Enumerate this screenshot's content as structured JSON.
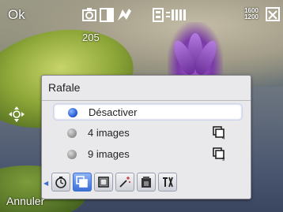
{
  "softkeys": {
    "left_top": "Ok",
    "bottom_left": "Annuler"
  },
  "status": {
    "shots_remaining": "205",
    "resolution_top": "1600",
    "resolution_bottom": "1200",
    "icons": [
      "camera-mode-icon",
      "contrast-icon",
      "flash-icon",
      "storage-icon",
      "white-balance-auto-icon",
      "close-icon"
    ]
  },
  "dialog": {
    "title": "Rafale",
    "options": [
      {
        "label": "Désactiver",
        "selected": true
      },
      {
        "label": "4 images",
        "selected": false,
        "icon": "burst-4-icon"
      },
      {
        "label": "9 images",
        "selected": false,
        "icon": "burst-9-icon"
      }
    ],
    "toolbar": [
      {
        "icon": "self-timer-icon",
        "active": false
      },
      {
        "icon": "burst-mode-icon",
        "active": true
      },
      {
        "icon": "frame-icon",
        "active": false
      },
      {
        "icon": "effects-icon",
        "active": false
      },
      {
        "icon": "brightness-icon",
        "active": false
      },
      {
        "icon": "settings-tools-icon",
        "active": false
      }
    ]
  },
  "colors": {
    "accent": "#3b6fd0",
    "dialog_bg": "#e9e9ec"
  }
}
